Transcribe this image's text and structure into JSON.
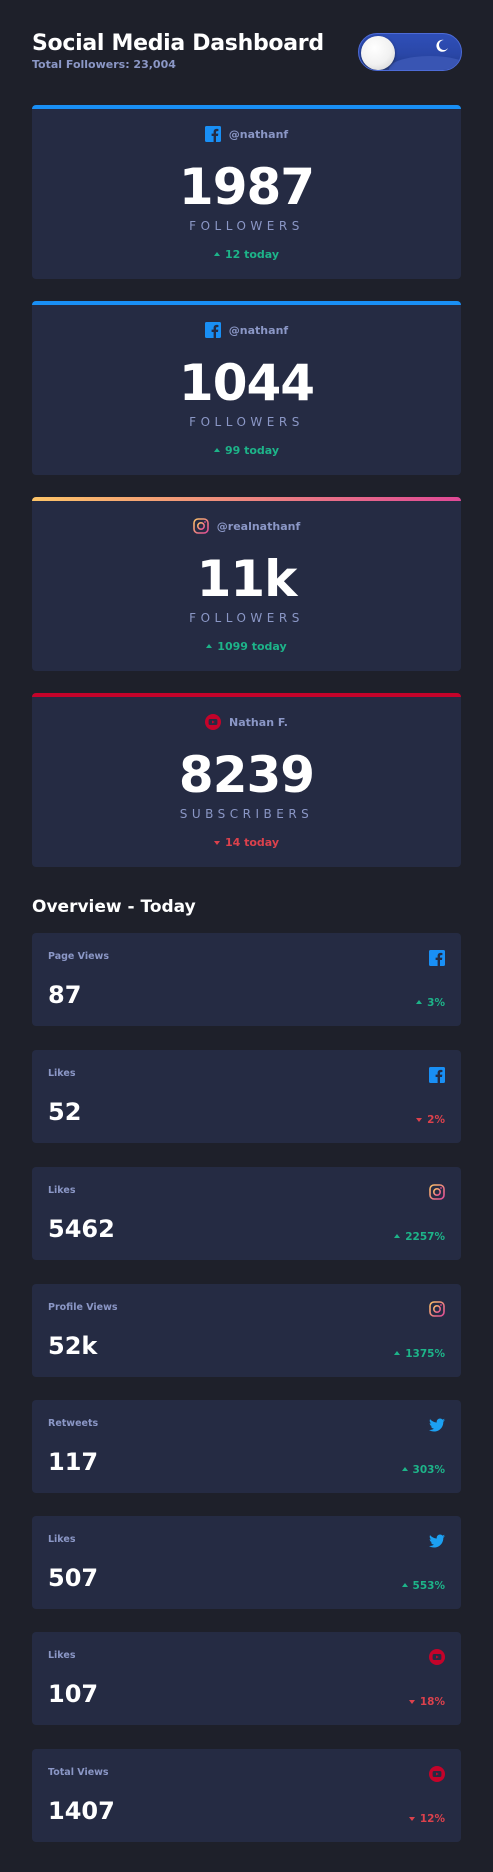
{
  "header": {
    "title": "Social Media Dashboard",
    "subtitle": "Total Followers: 23,004",
    "theme_toggle": "dark-mode-on"
  },
  "colors": {
    "background": "#1e202a",
    "card": "#252b43",
    "muted_text": "#8b97c6",
    "up": "#1db489",
    "down": "#dc414c",
    "facebook": "#198ff5",
    "twitter": "#1ca0f2",
    "instagram_gradient": [
      "#fdc468",
      "#df4996"
    ],
    "youtube": "#c4032a"
  },
  "follower_cards": [
    {
      "platform_icon": "facebook-icon",
      "handle": "@nathanf",
      "count": "1987",
      "unit": "FOLLOWERS",
      "delta": "12 today",
      "direction": "up"
    },
    {
      "platform_icon": "facebook-icon",
      "handle": "@nathanf",
      "count": "1044",
      "unit": "FOLLOWERS",
      "delta": "99 today",
      "direction": "up"
    },
    {
      "platform_icon": "instagram-icon",
      "handle": "@realnathanf",
      "count": "11k",
      "unit": "FOLLOWERS",
      "delta": "1099 today",
      "direction": "up"
    },
    {
      "platform_icon": "youtube-icon",
      "handle": "Nathan F.",
      "count": "8239",
      "unit": "SUBSCRIBERS",
      "delta": "14 today",
      "direction": "down"
    }
  ],
  "overview": {
    "title": "Overview - Today",
    "cards": [
      {
        "label": "Page Views",
        "platform_icon": "facebook-icon",
        "value": "87",
        "change": "3%",
        "direction": "up"
      },
      {
        "label": "Likes",
        "platform_icon": "facebook-icon",
        "value": "52",
        "change": "2%",
        "direction": "down"
      },
      {
        "label": "Likes",
        "platform_icon": "instagram-icon",
        "value": "5462",
        "change": "2257%",
        "direction": "up"
      },
      {
        "label": "Profile Views",
        "platform_icon": "instagram-icon",
        "value": "52k",
        "change": "1375%",
        "direction": "up"
      },
      {
        "label": "Retweets",
        "platform_icon": "twitter-icon",
        "value": "117",
        "change": "303%",
        "direction": "up"
      },
      {
        "label": "Likes",
        "platform_icon": "twitter-icon",
        "value": "507",
        "change": "553%",
        "direction": "up"
      },
      {
        "label": "Likes",
        "platform_icon": "youtube-icon",
        "value": "107",
        "change": "18%",
        "direction": "down"
      },
      {
        "label": "Total Views",
        "platform_icon": "youtube-icon",
        "value": "1407",
        "change": "12%",
        "direction": "down"
      }
    ]
  }
}
